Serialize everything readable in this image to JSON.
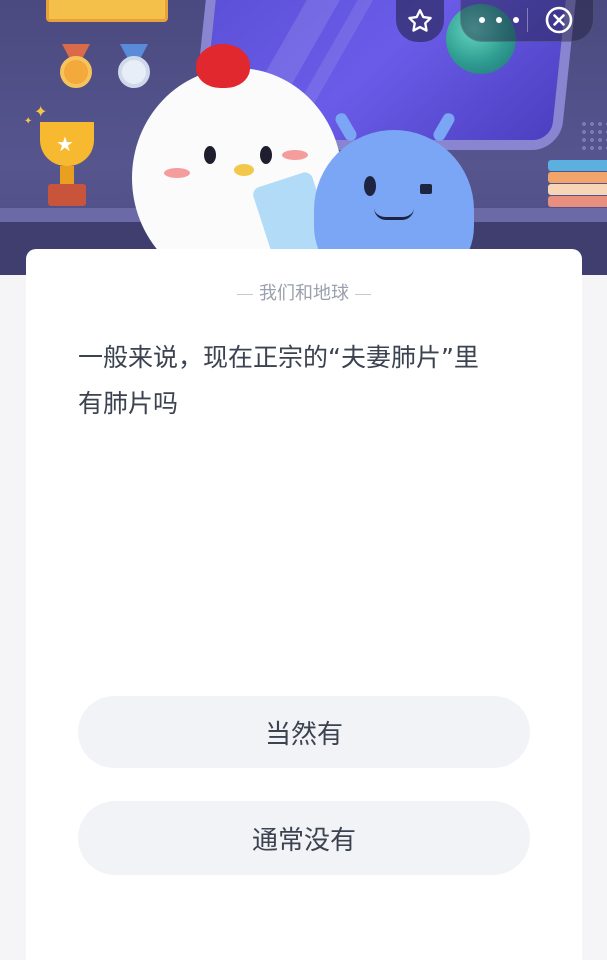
{
  "header": {
    "favorite_icon": "star-outline-icon",
    "more_icon": "more-dots-icon",
    "close_icon": "close-circle-icon"
  },
  "quiz": {
    "topic": "我们和地球",
    "question": "一般来说，现在正宗的“夫妻肺片”里有肺片吗",
    "options": [
      {
        "label": "当然有"
      },
      {
        "label": "通常没有"
      }
    ]
  },
  "colors": {
    "header_bg": "#4a4a80",
    "card_bg": "#ffffff",
    "option_bg": "#f2f3f6",
    "text_primary": "#3b4250",
    "text_secondary": "#9aa0ad"
  }
}
